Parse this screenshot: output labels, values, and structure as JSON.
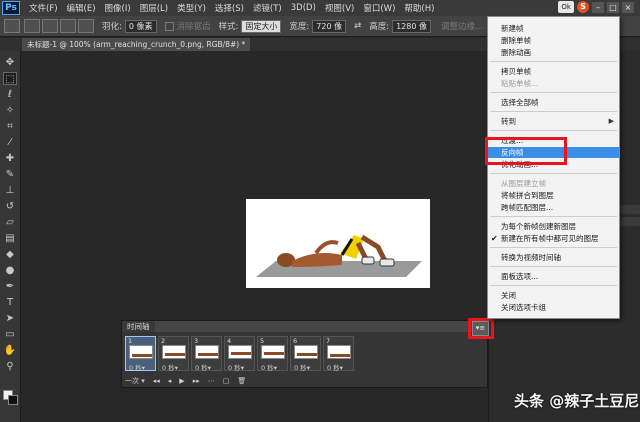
{
  "menubar": {
    "logo": "Ps",
    "items": [
      "文件(F)",
      "编辑(E)",
      "图像(I)",
      "图层(L)",
      "类型(Y)",
      "选择(S)",
      "滤镜(T)",
      "3D(D)",
      "视图(V)",
      "窗口(W)",
      "帮助(H)"
    ],
    "ok_badge": "Ok",
    "s_icon": "S",
    "minimize": "–",
    "maximize": "□",
    "close": "×"
  },
  "options": {
    "feather_label": "羽化:",
    "feather_value": "0 像素",
    "antialias_label": "消除锯齿",
    "style_label": "样式:",
    "style_value": "固定大小",
    "width_label": "宽度:",
    "width_value": "720 像",
    "swap_icon": "⇄",
    "height_label": "高度:",
    "height_value": "1280 像",
    "refine_edge": "调整边缘..."
  },
  "document": {
    "tab_title": "未标题-1 @ 100% (arm_reaching_crunch_0.png, RGB/8#) *"
  },
  "timeline": {
    "title": "时间轴",
    "panel_menu_icon": "▾≡",
    "frames": [
      {
        "num": "1",
        "delay": "0 秒▾"
      },
      {
        "num": "2",
        "delay": "0 秒▾"
      },
      {
        "num": "3",
        "delay": "0 秒▾"
      },
      {
        "num": "4",
        "delay": "0 秒▾"
      },
      {
        "num": "5",
        "delay": "0 秒▾"
      },
      {
        "num": "6",
        "delay": "0 秒▾"
      },
      {
        "num": "7",
        "delay": "0 秒▾"
      }
    ],
    "loop_option": "一次 ▾",
    "btn_first": "◂◂",
    "btn_prev": "◂",
    "btn_play": "▶",
    "btn_next": "▸▸",
    "btn_tween": "⋯",
    "btn_new": "▢",
    "btn_delete": "🗑"
  },
  "context_menu": {
    "items": [
      {
        "label": "新建帧"
      },
      {
        "label": "删除单帧"
      },
      {
        "label": "删除动画"
      },
      {
        "label": "拷贝单帧"
      },
      {
        "label": "粘贴单帧..."
      },
      {
        "label": "选择全部帧"
      },
      {
        "label": "转到"
      },
      {
        "label": "过渡..."
      },
      {
        "label": "反向帧"
      },
      {
        "label": "优化动画..."
      },
      {
        "label": "从图层建立帧"
      },
      {
        "label": "将帧拼合到图层"
      },
      {
        "label": "跨帧匹配图层..."
      },
      {
        "label": "为每个新帧创建新图层"
      },
      {
        "label": "新建在所有帧中都可见的图层"
      },
      {
        "label": "转换为视频时间轴"
      },
      {
        "label": "面板选项..."
      },
      {
        "label": "关闭"
      },
      {
        "label": "关闭选项卡组"
      }
    ],
    "checkmark": "✔",
    "submenu_arrow": "▶"
  },
  "watermark": "头条 @辣子土豆尼",
  "colors": {
    "highlight": "#3a8ee6",
    "annotation_red": "#e8141e",
    "workspace": "#282828"
  }
}
